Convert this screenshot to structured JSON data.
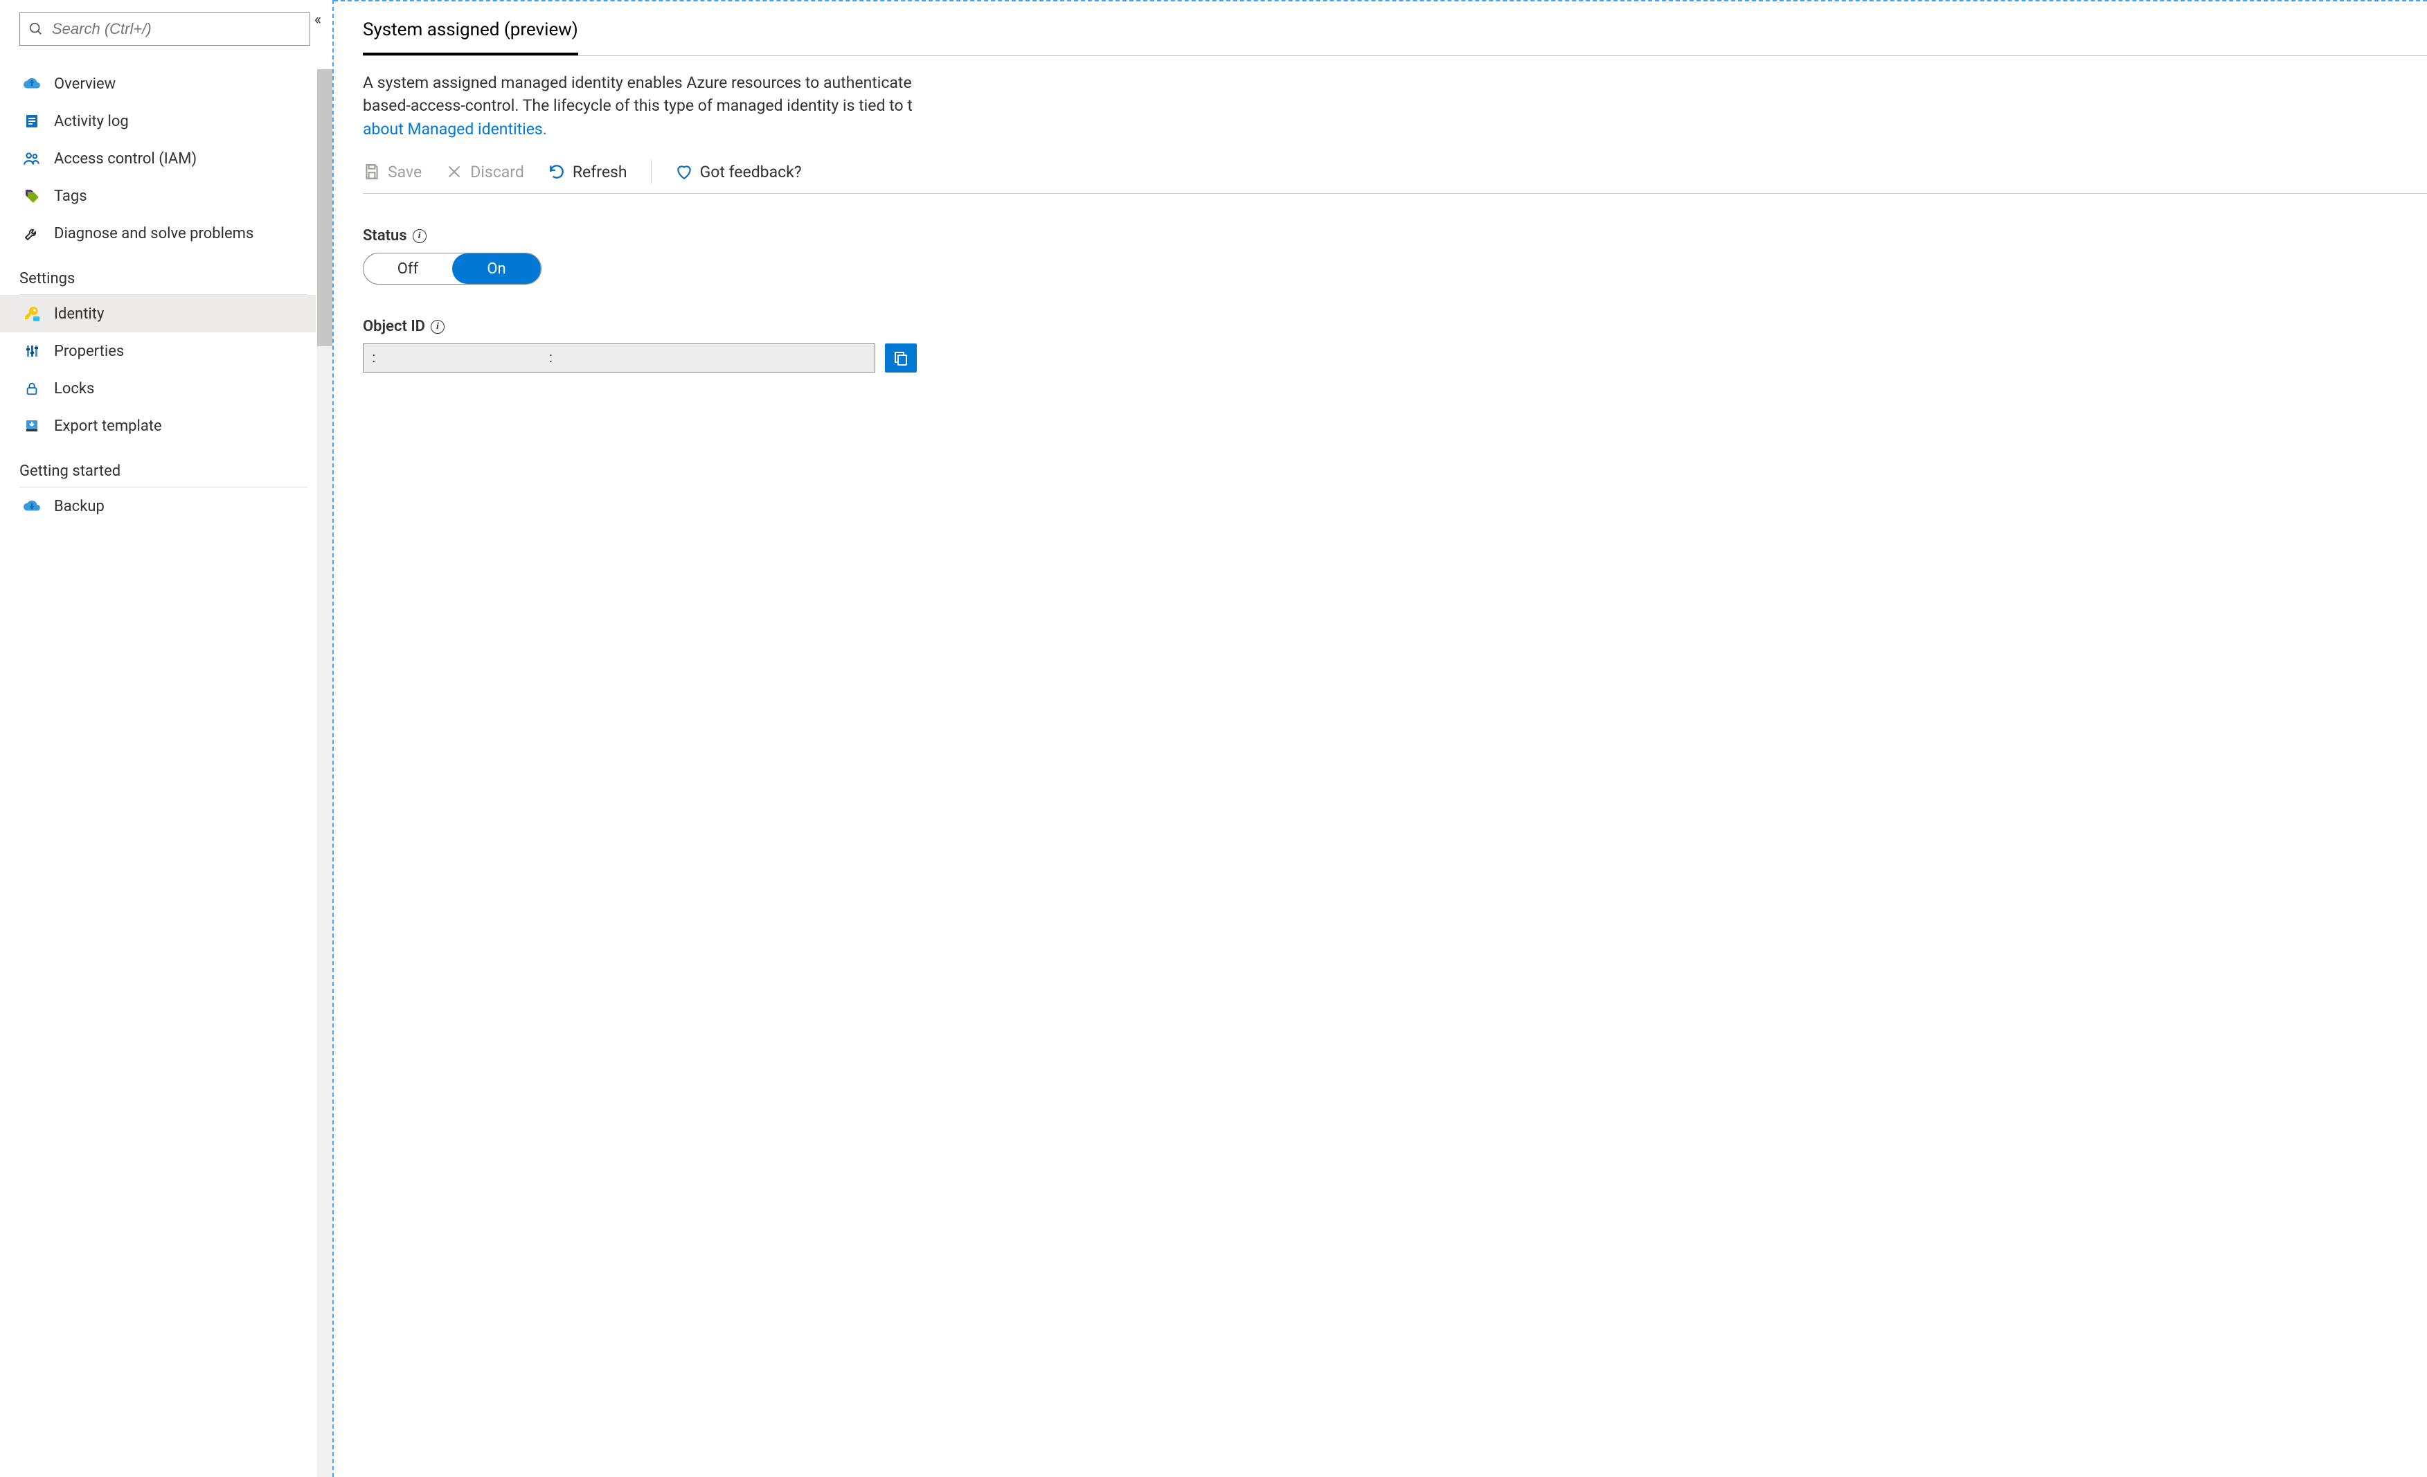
{
  "search": {
    "placeholder": "Search (Ctrl+/)"
  },
  "sidebar": {
    "top": [
      {
        "label": "Overview"
      },
      {
        "label": "Activity log"
      },
      {
        "label": "Access control (IAM)"
      },
      {
        "label": "Tags"
      },
      {
        "label": "Diagnose and solve problems"
      }
    ],
    "sections": [
      {
        "title": "Settings",
        "items": [
          {
            "label": "Identity"
          },
          {
            "label": "Properties"
          },
          {
            "label": "Locks"
          },
          {
            "label": "Export template"
          }
        ]
      },
      {
        "title": "Getting started",
        "items": [
          {
            "label": "Backup"
          }
        ]
      }
    ]
  },
  "tabs": {
    "system_assigned": "System assigned (preview)"
  },
  "description": {
    "line1": "A system assigned managed identity enables Azure resources to authenticate ",
    "line2": "based-access-control. The lifecycle of this type of managed identity is tied to t",
    "link": "about Managed identities."
  },
  "toolbar": {
    "save": "Save",
    "discard": "Discard",
    "refresh": "Refresh",
    "feedback": "Got feedback?"
  },
  "status": {
    "label": "Status",
    "off": "Off",
    "on": "On",
    "value": "On"
  },
  "objectid": {
    "label": "Object ID",
    "value_a": ":",
    "value_b": ":"
  }
}
